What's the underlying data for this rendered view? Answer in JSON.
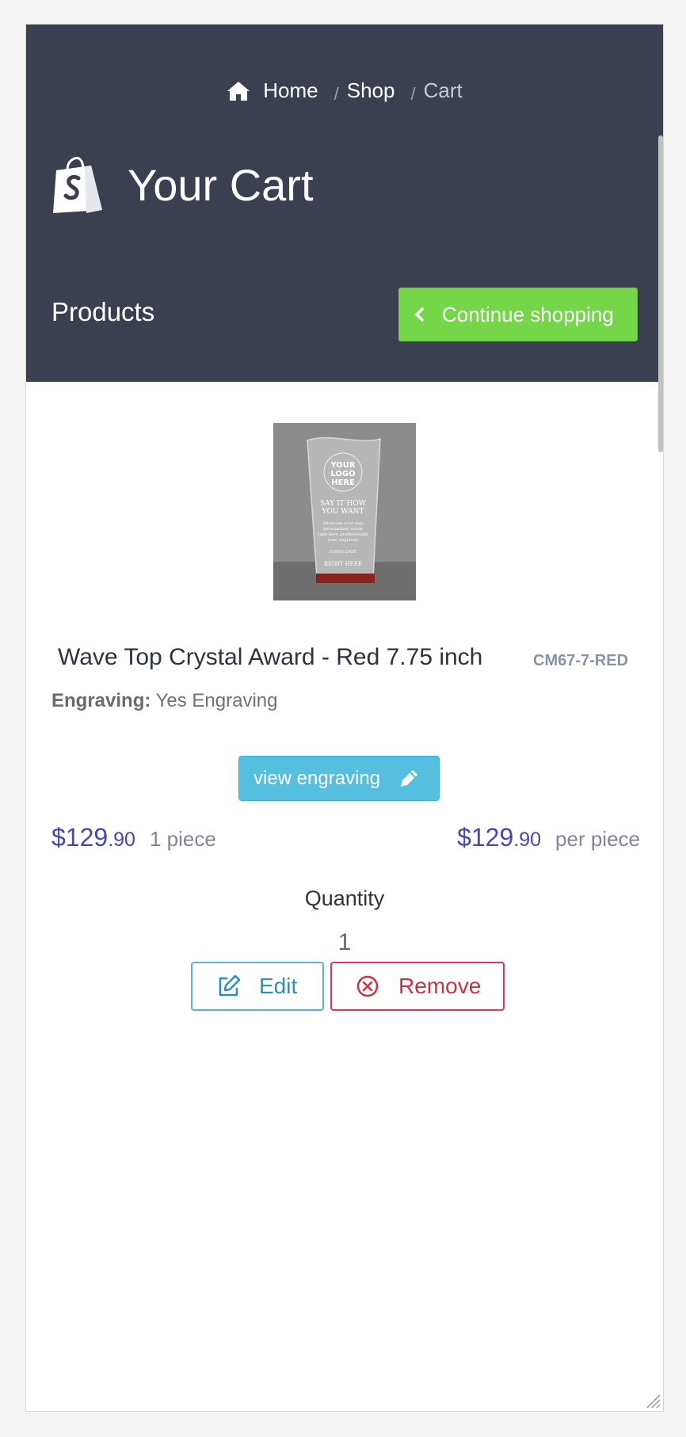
{
  "breadcrumb": {
    "home": "Home",
    "separator": "/",
    "shop": "Shop",
    "current": "Cart"
  },
  "header": {
    "title": "Your Cart",
    "logo_icon": "shopify-bag-icon"
  },
  "products_section": {
    "label": "Products",
    "continue_button": "Continue shopping"
  },
  "product": {
    "name": "Wave Top Crystal Award - Red 7.75 inch",
    "sku": "CM67-7-RED",
    "image_text": {
      "line1": "YOUR",
      "line2": "LOGO",
      "line3": "HERE",
      "line4": "SAY IT HOW",
      "line5": "YOU WANT",
      "line6": "Showcase your own",
      "line7": "personalized words",
      "line8": "right here, professionally",
      "line9": "laser engraved",
      "line10": "EVENT DATE",
      "line11": "RIGHT HERE"
    },
    "engraving_label": "Engraving:",
    "engraving_value": "Yes Engraving",
    "view_engraving_button": "view engraving",
    "total_price_main": "$129",
    "total_price_cents": ".90",
    "total_unit": "1 piece",
    "unit_price_main": "$129",
    "unit_price_cents": ".90",
    "unit_label": "per piece",
    "quantity_label": "Quantity",
    "quantity_value": "1",
    "edit_button": "Edit",
    "remove_button": "Remove"
  },
  "colors": {
    "header_bg": "#3a4050",
    "continue_green": "#75d64a",
    "view_engraving_blue": "#56bedf",
    "price_blue": "#4747b3",
    "remove_red": "#d02f3c"
  }
}
